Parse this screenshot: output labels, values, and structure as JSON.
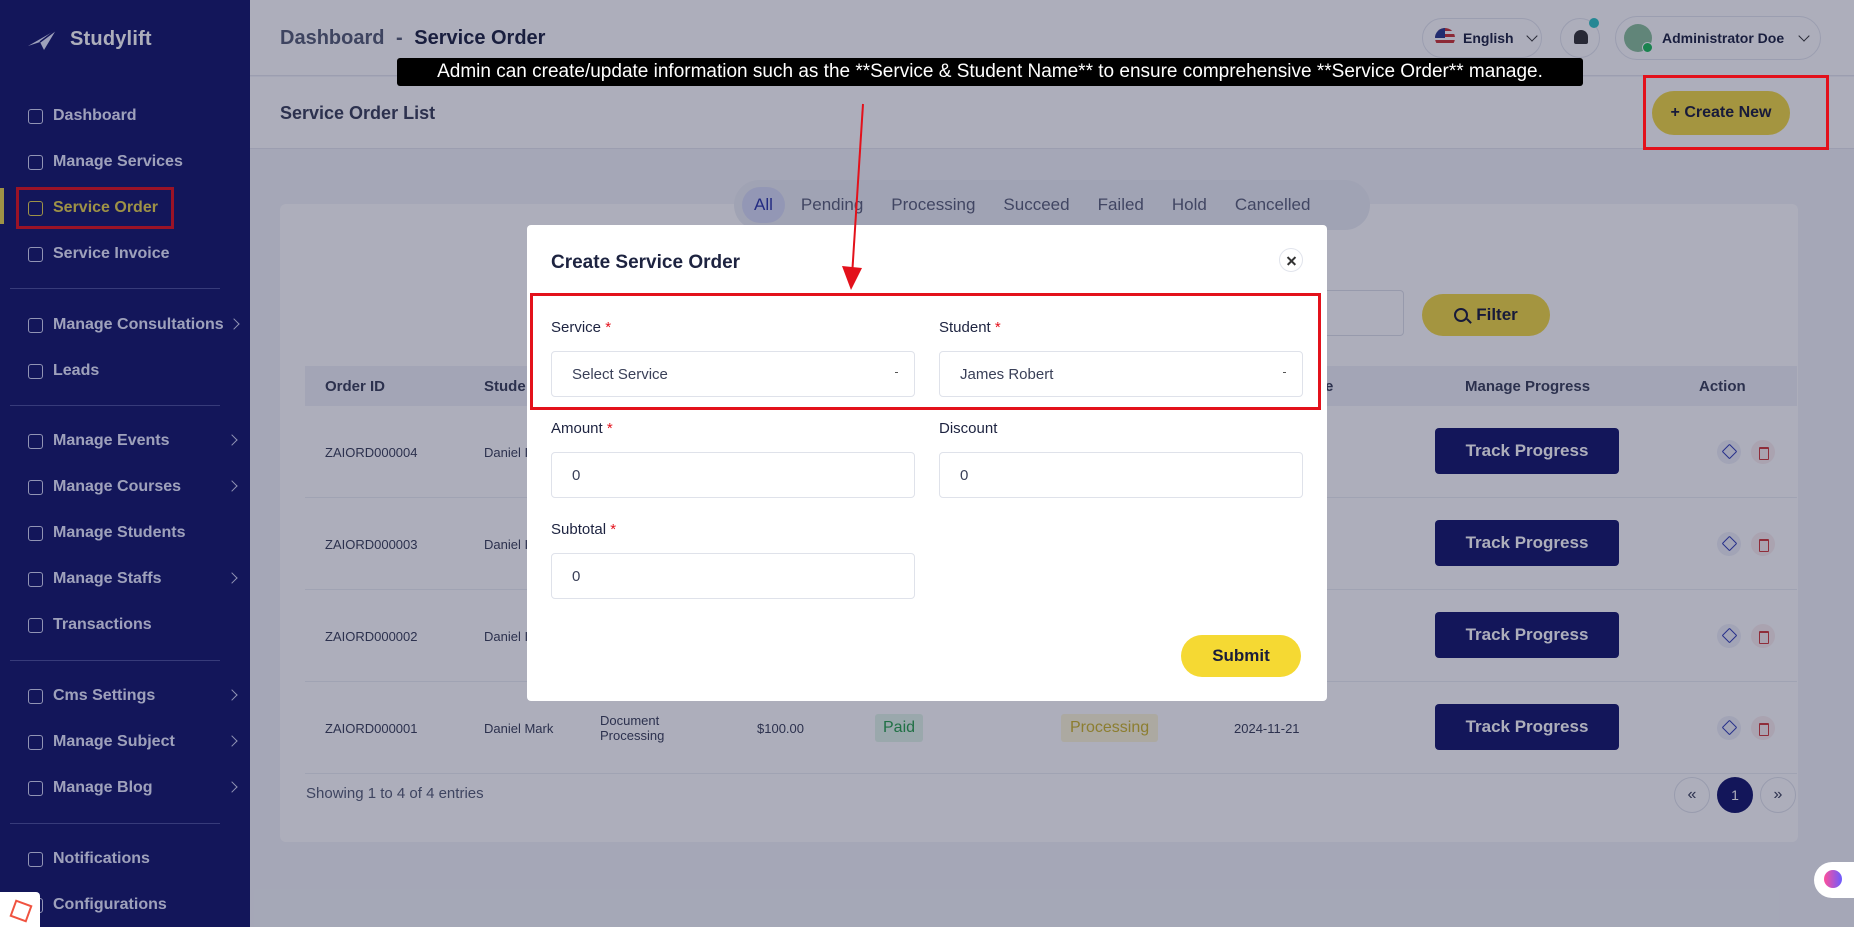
{
  "app": {
    "name": "Studylift"
  },
  "sidebar": {
    "items": [
      {
        "label": "Dashboard",
        "icon": "dashboard-icon"
      },
      {
        "label": "Manage Services",
        "icon": "services-icon"
      },
      {
        "label": "Service Order",
        "icon": "order-icon",
        "active": true
      },
      {
        "label": "Service Invoice",
        "icon": "invoice-icon"
      },
      {
        "label": "Manage Consultations",
        "icon": "consultation-icon"
      },
      {
        "label": "Leads",
        "icon": "leads-icon"
      },
      {
        "label": "Manage Events",
        "icon": "events-icon"
      },
      {
        "label": "Manage Courses",
        "icon": "courses-icon"
      },
      {
        "label": "Manage Students",
        "icon": "students-icon"
      },
      {
        "label": "Manage Staffs",
        "icon": "staffs-icon"
      },
      {
        "label": "Transactions",
        "icon": "transactions-icon"
      },
      {
        "label": "Cms Settings",
        "icon": "cms-icon"
      },
      {
        "label": "Manage Subject",
        "icon": "subject-icon"
      },
      {
        "label": "Manage Blog",
        "icon": "blog-icon"
      },
      {
        "label": "Notifications",
        "icon": "bell-icon"
      },
      {
        "label": "Configurations",
        "icon": "config-icon"
      }
    ]
  },
  "header": {
    "breadcrumb_root": "Dashboard",
    "breadcrumb_sep": "-",
    "breadcrumb_current": "Service Order",
    "language": "English",
    "user_name": "Administrator Doe"
  },
  "page": {
    "title": "Service Order List",
    "create_label": "+ Create New"
  },
  "tabs": [
    "All",
    "Pending",
    "Processing",
    "Succeed",
    "Failed",
    "Hold",
    "Cancelled"
  ],
  "filter_label": "Filter",
  "table": {
    "headers": {
      "order_id": "Order ID",
      "student": "Stude",
      "date_tail": "e",
      "progress": "Manage Progress",
      "action": "Action"
    },
    "rows": [
      {
        "order_id": "ZAIORD000004",
        "student": "Daniel I"
      },
      {
        "order_id": "ZAIORD000003",
        "student": "Daniel I"
      },
      {
        "order_id": "ZAIORD000002",
        "student": "Daniel I"
      },
      {
        "order_id": "ZAIORD000001",
        "student": "Daniel Mark",
        "service": "Document Processing",
        "amount": "$100.00",
        "payment": "Paid",
        "status": "Processing",
        "date": "2024-11-21"
      }
    ],
    "track_label": "Track Progress"
  },
  "showing": "Showing 1 to 4 of 4 entries",
  "pagination": {
    "prev": "«",
    "current": "1",
    "next": "»"
  },
  "modal": {
    "title": "Create Service Order",
    "service_label": "Service",
    "service_placeholder": "Select Service",
    "student_label": "Student",
    "student_value": "James Robert",
    "amount_label": "Amount",
    "amount_value": "0",
    "discount_label": "Discount",
    "discount_value": "0",
    "subtotal_label": "Subtotal",
    "subtotal_value": "0",
    "required_mark": "*",
    "submit_label": "Submit"
  },
  "annotation": {
    "banner": "Admin can create/update information such as the **Service & Student Name** to ensure comprehensive **Service Order** manage.",
    "highlight_color": "#e3111b"
  }
}
